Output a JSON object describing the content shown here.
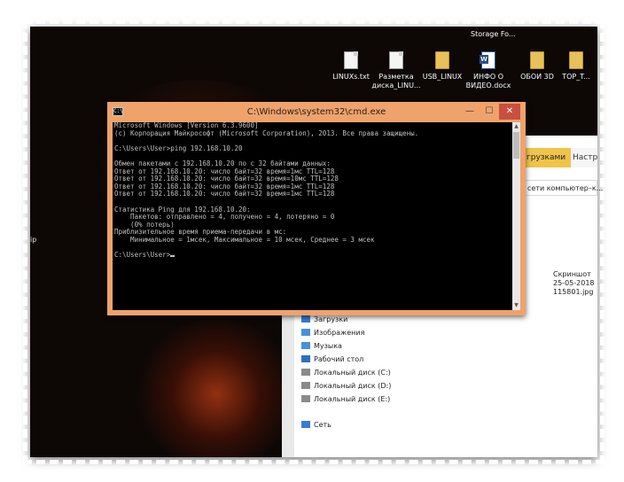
{
  "desktop": {
    "storage_label": "Storage Fo...",
    "icons": [
      {
        "label": "LINUXs.txt",
        "type": "doc"
      },
      {
        "label": "Разметка диска_LINU...",
        "type": "doc"
      },
      {
        "label": "USB_LINUX",
        "type": "folder"
      },
      {
        "label": "ИНФО О ВИДЕО.docx",
        "type": "word"
      },
      {
        "label": "ОБОИ 3D",
        "type": "folder"
      },
      {
        "label": "TOP_T...",
        "type": "folder"
      }
    ],
    "left_edge_text": "ip"
  },
  "cmd": {
    "title": "C:\\Windows\\system32\\cmd.exe",
    "icon_text": "C:\\",
    "minimize": "—",
    "maximize": "☐",
    "close": "✕",
    "lines": [
      "Microsoft Windows [Version 6.3.9600]",
      "(c) Корпорация Майкрософт (Microsoft Corporation), 2013. Все права защищены.",
      "",
      "C:\\Users\\User>ping 192.168.10.20",
      "",
      "Обмен пакетами с 192.168.10.20 по с 32 байтами данных:",
      "Ответ от 192.168.10.20: число байт=32 время=1мс TTL=128",
      "Ответ от 192.168.10.20: число байт=32 время=10мс TTL=128",
      "Ответ от 192.168.10.20: число байт=32 время=1мс TTL=128",
      "Ответ от 192.168.10.20: число байт=32 время=1мс TTL=128",
      "",
      "Статистика Ping для 192.168.10.20:",
      "    Пакетов: отправлено = 4, получено = 4, потеряно = 0",
      "    (0% потерь)",
      "Приблизительное время приема-передачи в мс:",
      "    Минимальное = 1мсек, Максимальное = 10 мсек, Среднее = 3 мсек",
      "",
      "C:\\Users\\User>"
    ]
  },
  "explorer": {
    "tabs": [
      "грузками",
      "Настр"
    ],
    "breadcrumb": "сети компьютер–к...",
    "file_caption": [
      "Скриншот",
      "25-05-2018",
      "115801.jpg"
    ],
    "nav": [
      {
        "label": "Загрузки",
        "icon": "download-icon",
        "color": "#3a7bd5"
      },
      {
        "label": "Изображения",
        "icon": "pictures-icon",
        "color": "#4a90d9"
      },
      {
        "label": "Музыка",
        "icon": "music-icon",
        "color": "#4a90d9"
      },
      {
        "label": "Рабочий стол",
        "icon": "desktop-icon",
        "color": "#2f6fbf"
      },
      {
        "label": "Локальный диск (C:)",
        "icon": "drive-icon",
        "color": "#8a8a8a"
      },
      {
        "label": "Локальный диск (D:)",
        "icon": "drive-icon",
        "color": "#8a8a8a"
      },
      {
        "label": "Локальный диск (E:)",
        "icon": "drive-icon",
        "color": "#8a8a8a"
      },
      {
        "label": "Сеть",
        "icon": "network-icon",
        "color": "#3a7bd5"
      }
    ]
  }
}
